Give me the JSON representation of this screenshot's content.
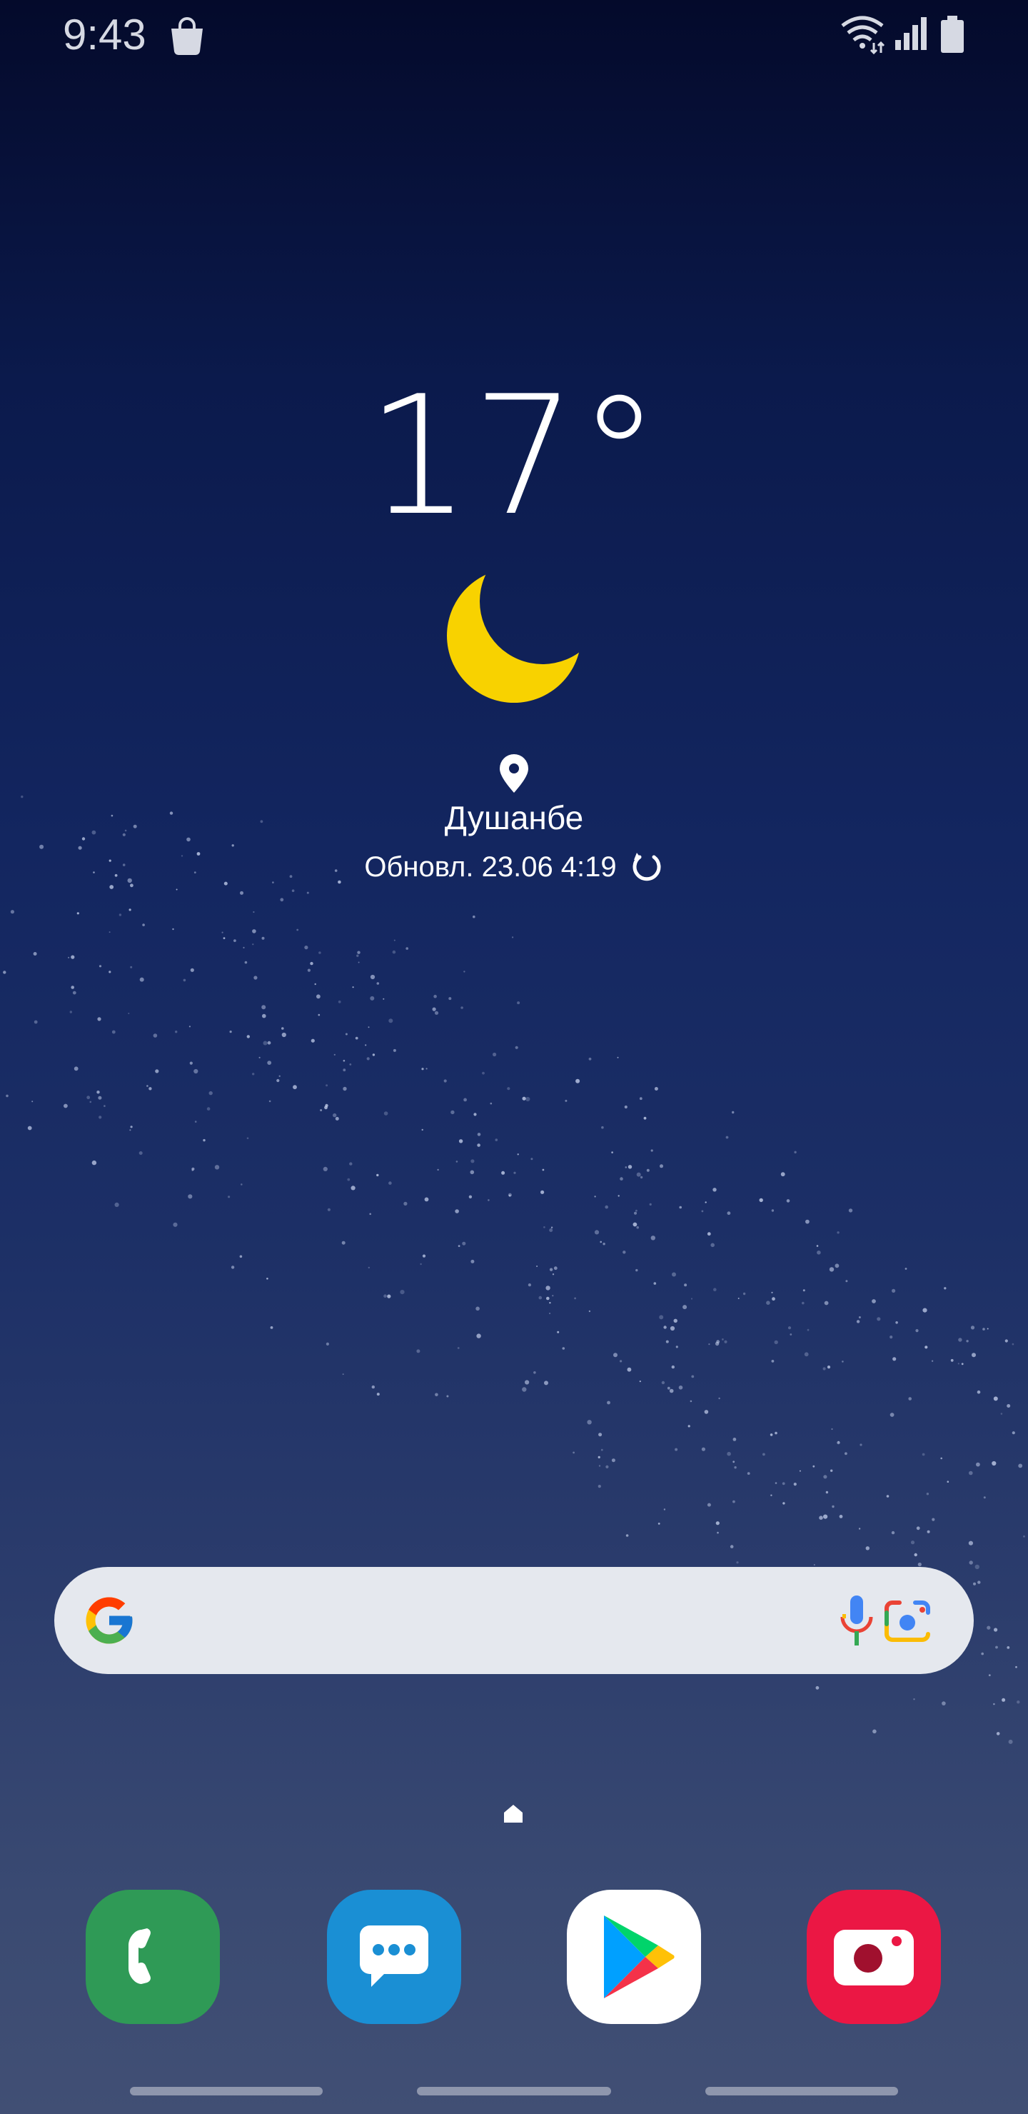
{
  "status_bar": {
    "time": "9:43",
    "icons": [
      "shopping-bag-icon",
      "wifi-icon",
      "signal-icon",
      "battery-icon"
    ]
  },
  "weather": {
    "temperature": "17°",
    "condition_icon": "crescent-moon-icon",
    "location": "Душанбе",
    "updated": "Обновл. 23.06 4:19"
  },
  "search": {
    "icons": [
      "google-g-icon",
      "microphone-icon",
      "google-lens-icon"
    ]
  },
  "dock": {
    "apps": [
      "phone",
      "messages",
      "play-store",
      "camera"
    ]
  },
  "colors": {
    "moon": "#f8d200",
    "phone": "#2f9a56",
    "messages": "#1a8fd4",
    "camera": "#eb1744",
    "search_bg": "#e5e8ee"
  }
}
